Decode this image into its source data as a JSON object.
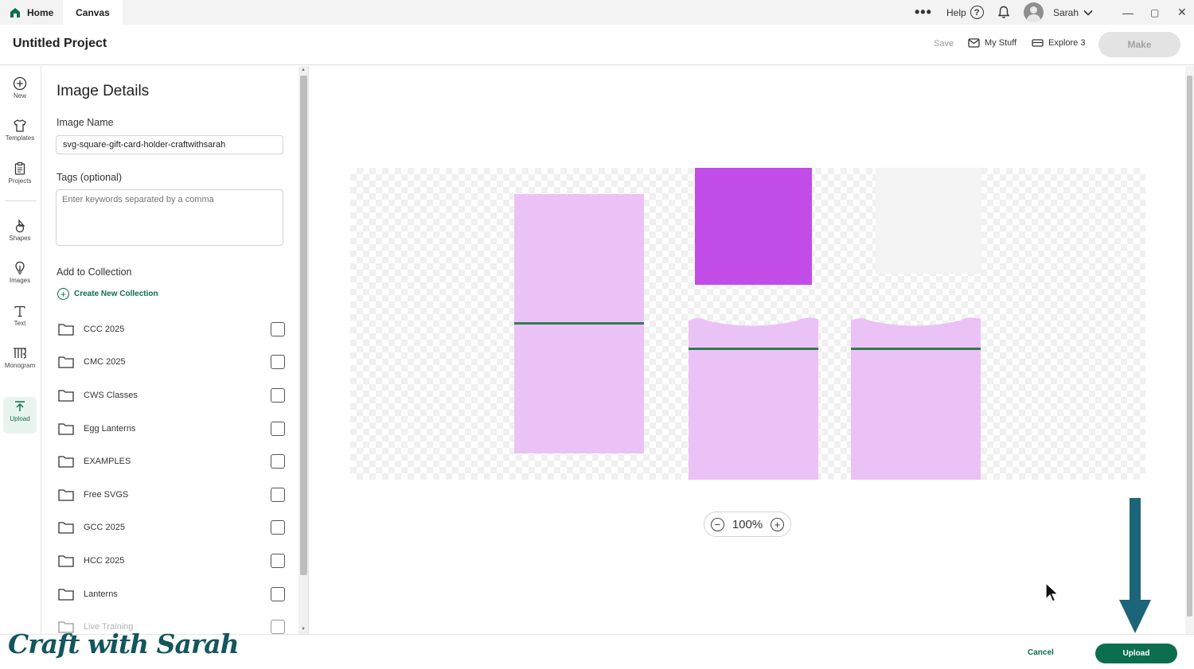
{
  "titlebar": {
    "tabs": [
      {
        "label": "Home"
      },
      {
        "label": "Canvas"
      }
    ],
    "help_label": "Help",
    "help_glyph": "?",
    "more_glyph": "•••",
    "user_name": "Sarah",
    "minimize_glyph": "—",
    "maximize_glyph": "▢",
    "close_glyph": "✕"
  },
  "header": {
    "project_title": "Untitled Project",
    "save_label": "Save",
    "my_stuff_label": "My Stuff",
    "machine_label": "Explore 3",
    "make_label": "Make"
  },
  "toolbar": {
    "items": [
      {
        "label": "New",
        "icon": "plus-circle-icon"
      },
      {
        "label": "Templates",
        "icon": "shirt-icon"
      },
      {
        "label": "Projects",
        "icon": "clipboard-icon"
      },
      {
        "label": "Shapes",
        "icon": "shapes-icon"
      },
      {
        "label": "Images",
        "icon": "lightbulb-icon"
      },
      {
        "label": "Text",
        "icon": "text-icon"
      },
      {
        "label": "Monogram",
        "icon": "monogram-icon"
      },
      {
        "label": "Upload",
        "icon": "upload-icon"
      }
    ],
    "active": "Upload"
  },
  "details": {
    "title": "Image Details",
    "image_name_label": "Image Name",
    "image_name_value": "svg-square-gift-card-holder-craftwithsarah",
    "tags_label": "Tags (optional)",
    "tags_placeholder": "Enter keywords separated by a comma",
    "collection_label": "Add to Collection",
    "create_collection_label": "Create New Collection",
    "collections": [
      {
        "name": "CCC 2025",
        "checked": false
      },
      {
        "name": "CMC 2025",
        "checked": false
      },
      {
        "name": "CWS Classes",
        "checked": false
      },
      {
        "name": "Egg Lanterns",
        "checked": false
      },
      {
        "name": "EXAMPLES",
        "checked": false
      },
      {
        "name": "Free SVGS",
        "checked": false
      },
      {
        "name": "GCC 2025",
        "checked": false
      },
      {
        "name": "HCC 2025",
        "checked": false
      },
      {
        "name": "Lanterns",
        "checked": false
      },
      {
        "name": "Live Training",
        "checked": false
      }
    ]
  },
  "canvas": {
    "zoom_level": "100%",
    "zoom_out_glyph": "−",
    "zoom_in_glyph": "+",
    "colors": {
      "light_pink": "#ebc2f6",
      "magenta": "#c24ce8",
      "fold_line": "#2f7a52",
      "pale": "#f4f4f4"
    }
  },
  "footer": {
    "logo_text": "Craft with Sarah",
    "cancel_label": "Cancel",
    "upload_label": "Upload"
  },
  "colors": {
    "brand_green": "#0b6e4f",
    "annotation_arrow": "#1c6478"
  }
}
